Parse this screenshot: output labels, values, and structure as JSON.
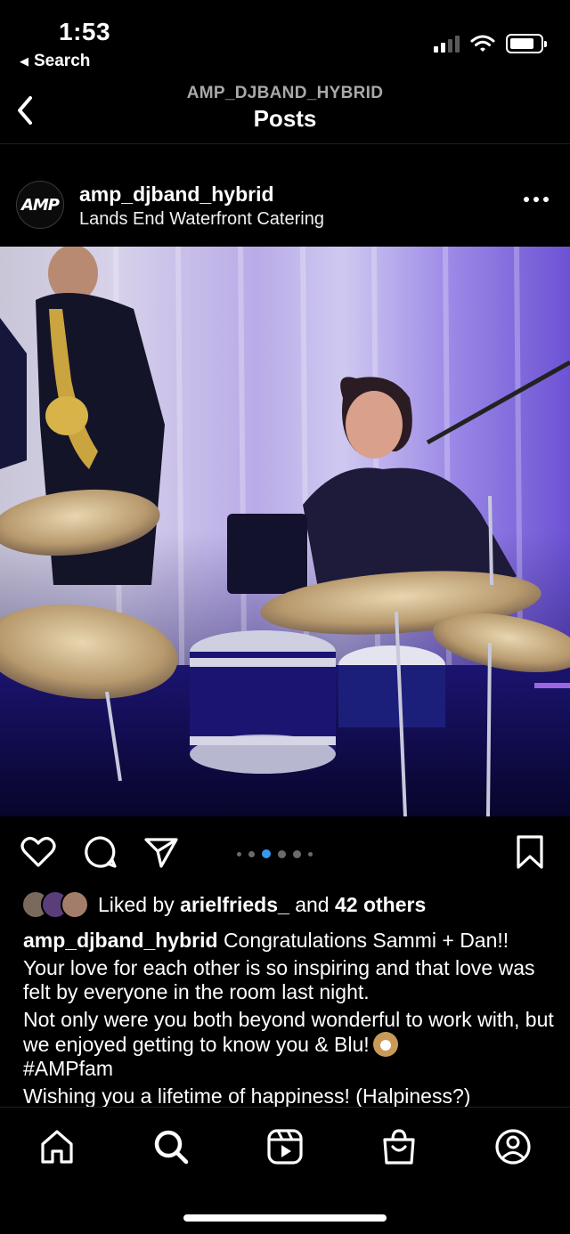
{
  "status": {
    "time": "1:53",
    "back_app": "Search"
  },
  "header": {
    "subtitle": "AMP_DJBAND_HYBRID",
    "title": "Posts"
  },
  "post": {
    "username": "amp_djband_hybrid",
    "location": "Lands End Waterfront Catering",
    "avatar_text": "AMP",
    "carousel": {
      "count": 5,
      "active_index": 1
    },
    "likes": {
      "prefix": "Liked by",
      "user": "arielfrieds_",
      "middle": "and",
      "others": "42 others"
    },
    "caption": {
      "user": "amp_djband_hybrid",
      "line1": "Congratulations Sammi + Dan!!",
      "line2": "Your love for each other is so inspiring and that love was felt by everyone in the room last night.",
      "line3": "Not only were you both beyond wonderful to work with, but we enjoyed getting to know you & Blu!",
      "line4": "#AMPfam",
      "line5": "Wishing you a lifetime of happiness! (Halpiness?)"
    }
  },
  "tabs": [
    "home-icon",
    "search-icon",
    "reels-icon",
    "shop-icon",
    "profile-icon"
  ],
  "colors": {
    "active_dot": "#3897f0",
    "background": "#000000"
  }
}
